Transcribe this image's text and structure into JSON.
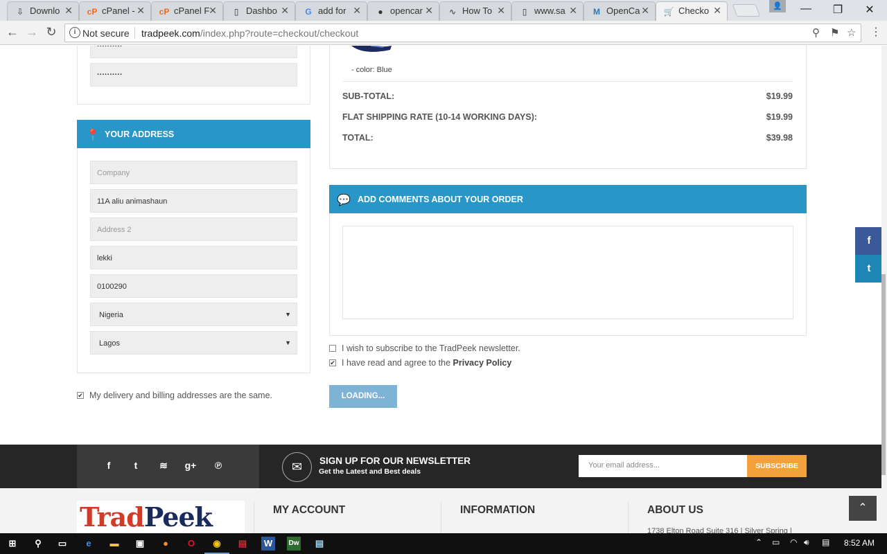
{
  "browser": {
    "tabs": [
      {
        "label": "Downlo",
        "icon": "download-icon"
      },
      {
        "label": "cPanel -",
        "icon": "cpanel-icon"
      },
      {
        "label": "cPanel F",
        "icon": "cpanel-icon"
      },
      {
        "label": "Dashbo",
        "icon": "page-icon"
      },
      {
        "label": "add for",
        "icon": "google-icon"
      },
      {
        "label": "opencar",
        "icon": "github-icon"
      },
      {
        "label": "How To",
        "icon": "wave-icon"
      },
      {
        "label": "www.sa",
        "icon": "page-icon"
      },
      {
        "label": "OpenCa",
        "icon": "opencart-icon"
      },
      {
        "label": "Checko",
        "icon": "cart-icon"
      }
    ],
    "security_label": "Not secure",
    "url_domain": "tradpeek.com",
    "url_path": "/index.php?route=checkout/checkout"
  },
  "password_field_1": "··········",
  "password_field_2": "··········",
  "address_panel": {
    "title": "YOUR ADDRESS",
    "company_placeholder": "Company",
    "address1": "11A aliu animashaun",
    "address2_placeholder": "Address 2",
    "city": "lekki",
    "postcode": "0100290",
    "country": "Nigeria",
    "region": "Lagos"
  },
  "same_address_label": "My delivery and billing addresses are the same.",
  "product_option": "- color: Blue",
  "summary": {
    "subtotal_label": "SUB-TOTAL:",
    "subtotal_value": "$19.99",
    "shipping_label": "FLAT SHIPPING RATE (10-14 WORKING DAYS):",
    "shipping_value": "$19.99",
    "total_label": "TOTAL:",
    "total_value": "$39.98"
  },
  "comments_panel": {
    "title": "ADD COMMENTS ABOUT YOUR ORDER"
  },
  "newsletter_check_label": "I wish to subscribe to the TradPeek newsletter.",
  "privacy_check_prefix": "I have read and agree to the ",
  "privacy_link": "Privacy Policy",
  "loading_button": "LOADING...",
  "newsletter": {
    "title": "SIGN UP FOR OUR NEWSLETTER",
    "subtitle": "Get the Latest and Best deals",
    "email_placeholder": "Your email address...",
    "subscribe_button": "SUBSCRIBE"
  },
  "footer": {
    "logo_part1": "Trad",
    "logo_part2": "Peek",
    "col1": "MY ACCOUNT",
    "col2": "INFORMATION",
    "col3": "ABOUT US",
    "address": "1738 Elton Road Suite 316 | Silver Spring |"
  },
  "taskbar": {
    "time": "8:52 AM"
  },
  "colors": {
    "panel_blue": "#2897c8",
    "loading_blue": "#7fb3d6",
    "subscribe_orange": "#f3a23b",
    "facebook_blue": "#3b5998",
    "twitter_blue": "#1d86b5"
  }
}
